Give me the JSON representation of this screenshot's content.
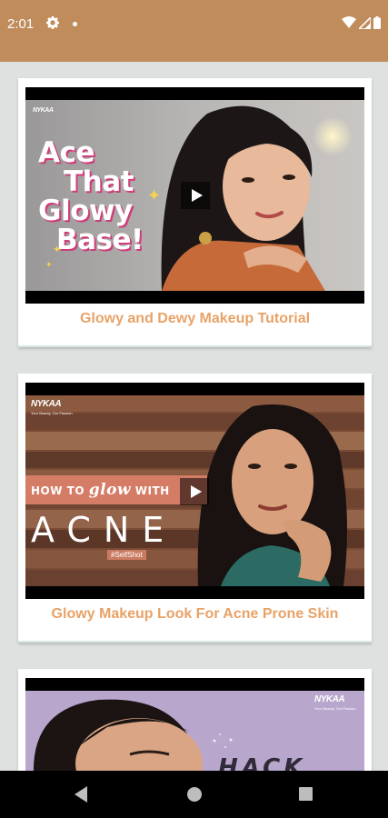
{
  "status_bar": {
    "time": "2:01",
    "icons": [
      "gear-icon",
      "notification-dot-icon",
      "wifi-icon",
      "signal-icon",
      "battery-icon"
    ],
    "background": "#c08c5c"
  },
  "videos": [
    {
      "title": "Glowy and Dewy Makeup Tutorial",
      "brand": "NYKAA",
      "overlay_lines": [
        "Ace",
        "That",
        "Glowy",
        "Base!"
      ]
    },
    {
      "title": "Glowy Makeup Look For Acne Prone Skin",
      "brand": "NYKAA",
      "brand_tagline": "Your Beauty, Our Passion",
      "overlay_prefix": "HOW TO",
      "overlay_script": "glow",
      "overlay_suffix": "WITH",
      "overlay_big": "ACNE",
      "overlay_tag": "#SelfShot"
    },
    {
      "title": "",
      "brand": "NYKAA",
      "brand_tagline": "Your Beauty, Our Passion",
      "overlay_line": "HACK THE"
    }
  ],
  "colors": {
    "title_text": "#e8a267",
    "page_background": "#dfe1e0",
    "card_background": "#ffffff"
  },
  "nav_bar": {
    "icons": [
      "back-icon",
      "home-icon",
      "recents-icon"
    ]
  }
}
